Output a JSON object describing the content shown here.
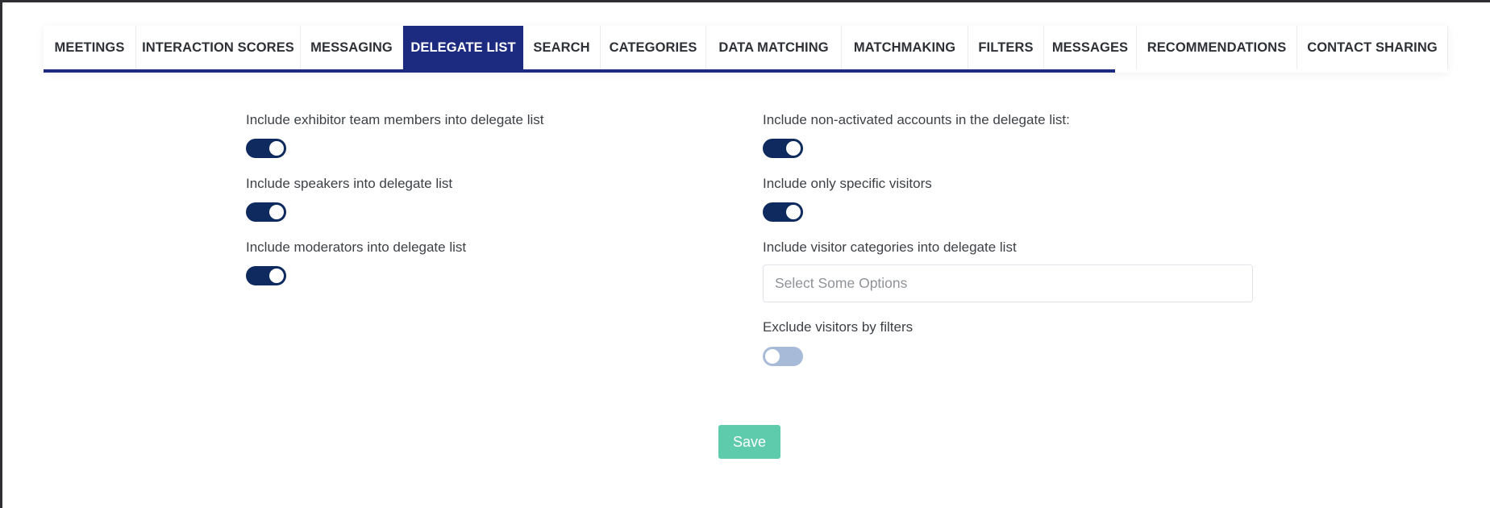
{
  "tabs": [
    {
      "label": "MEETINGS",
      "active": false
    },
    {
      "label": "INTERACTION SCORES",
      "active": false
    },
    {
      "label": "MESSAGING",
      "active": false
    },
    {
      "label": "DELEGATE LIST",
      "active": true
    },
    {
      "label": "SEARCH",
      "active": false
    },
    {
      "label": "CATEGORIES",
      "active": false
    },
    {
      "label": "DATA MATCHING",
      "active": false
    },
    {
      "label": "MATCHMAKING",
      "active": false
    },
    {
      "label": "FILTERS",
      "active": false
    },
    {
      "label": "MESSAGES",
      "active": false
    },
    {
      "label": "RECOMMENDATIONS",
      "active": false
    },
    {
      "label": "CONTACT SHARING",
      "active": false
    }
  ],
  "left_settings": [
    {
      "label": "Include exhibitor team members into delegate list",
      "enabled": true
    },
    {
      "label": "Include speakers into delegate list",
      "enabled": true
    },
    {
      "label": "Include moderators into delegate list",
      "enabled": true
    }
  ],
  "right_settings": {
    "non_activated": {
      "label": "Include non-activated accounts in the delegate list:",
      "enabled": true
    },
    "specific_visitors": {
      "label": "Include only specific visitors",
      "enabled": true
    },
    "visitor_categories": {
      "label": "Include visitor categories into delegate list",
      "placeholder": "Select Some Options"
    },
    "exclude_filters": {
      "label": "Exclude visitors by filters",
      "enabled": false
    }
  },
  "save_label": "Save",
  "colors": {
    "accent": "#1c2b80",
    "toggle_on": "#0e2a5e",
    "toggle_off": "#a7bad8",
    "save": "#5fcbad"
  }
}
